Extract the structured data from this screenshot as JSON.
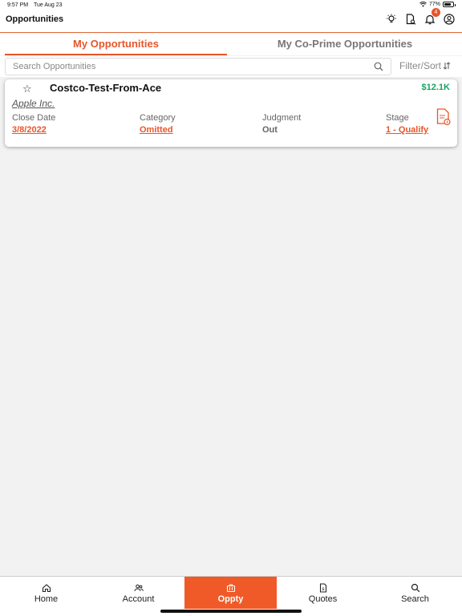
{
  "status_bar": {
    "time": "9:57 PM",
    "date": "Tue Aug 23",
    "battery": "77%"
  },
  "header": {
    "title": "Opportunities",
    "notification_count": "4"
  },
  "tabs": [
    {
      "label": "My Opportunities",
      "active": true
    },
    {
      "label": "My Co-Prime Opportunities",
      "active": false
    }
  ],
  "search": {
    "placeholder": "Search Opportunities",
    "value": "",
    "filter_label": "Filter/Sort"
  },
  "opportunities": [
    {
      "name": "Costco-Test-From-Ace",
      "amount": "$12.1K",
      "account": "Apple Inc.",
      "close_date_label": "Close Date",
      "close_date": "3/8/2022",
      "category_label": "Category",
      "category": "Omitted",
      "judgment_label": "Judgment",
      "judgment": "Out",
      "stage_label": "Stage",
      "stage": "1 - Qualify"
    }
  ],
  "nav": [
    {
      "label": "Home",
      "icon": "home-icon"
    },
    {
      "label": "Account",
      "icon": "users-icon"
    },
    {
      "label": "Oppty",
      "icon": "briefcase-icon",
      "active": true
    },
    {
      "label": "Quotes",
      "icon": "quote-document-icon"
    },
    {
      "label": "Search",
      "icon": "search-icon"
    }
  ],
  "colors": {
    "accent": "#e8552a",
    "amount": "#1aa364",
    "nav_active": "#f05a28"
  }
}
